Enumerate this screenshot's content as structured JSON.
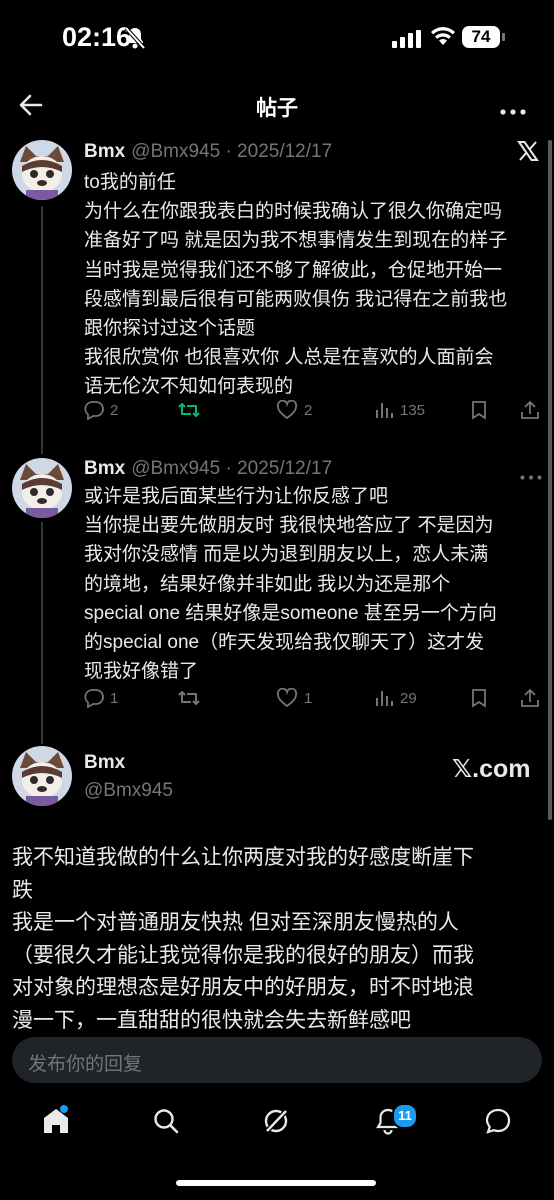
{
  "status_bar": {
    "time": "02:16",
    "battery": "74"
  },
  "header": {
    "title": "帖子"
  },
  "posts": [
    {
      "name": "Bmx",
      "handle": "@Bmx945 · 2025/12/17",
      "text": "to我的前任\n为什么在你跟我表白的时候我确认了很久你确定吗\n准备好了吗 就是因为我不想事情发生到现在的样子\n当时我是觉得我们还不够了解彼此，仓促地开始一\n段感情到最后很有可能两败俱伤 我记得在之前我也\n跟你探讨过这个话题\n我很欣赏你 也很喜欢你 人总是在喜欢的人面前会\n语无伦次不知如何表现的",
      "replies": "2",
      "reposts": "",
      "likes": "2",
      "views": "135"
    },
    {
      "name": "Bmx",
      "handle": "@Bmx945 · 2025/12/17",
      "text": "或许是我后面某些行为让你反感了吧\n当你提出要先做朋友时 我很快地答应了 不是因为\n我对你没感情 而是以为退到朋友以上，恋人未满\n的境地，结果好像并非如此 我以为还是那个\nspecial one 结果好像是someone 甚至另一个方向\n的special one（昨天发现给我仅聊天了）这才发\n现我好像错了",
      "replies": "1",
      "reposts": "",
      "likes": "1",
      "views": "29"
    }
  ],
  "card": {
    "name": "Bmx",
    "handle": "@Bmx945",
    "brand": "𝕏.com",
    "text": "我不知道我做的什么让你两度对我的好感度断崖下\n跌\n我是一个对普通朋友快热 但对至深朋友慢热的人\n（要很久才能让我觉得你是我的很好的朋友）而我\n对对象的理想态是好朋友中的好朋友，时不时地浪\n漫一下，一直甜甜的很快就会失去新鲜感吧"
  },
  "reply_bar": {
    "placeholder": "发布你的回复"
  },
  "nav": {
    "notifications_badge": "11"
  },
  "colors": {
    "accent": "#1d9bf0",
    "repost_active": "#00ba7c",
    "muted": "#71767b"
  }
}
